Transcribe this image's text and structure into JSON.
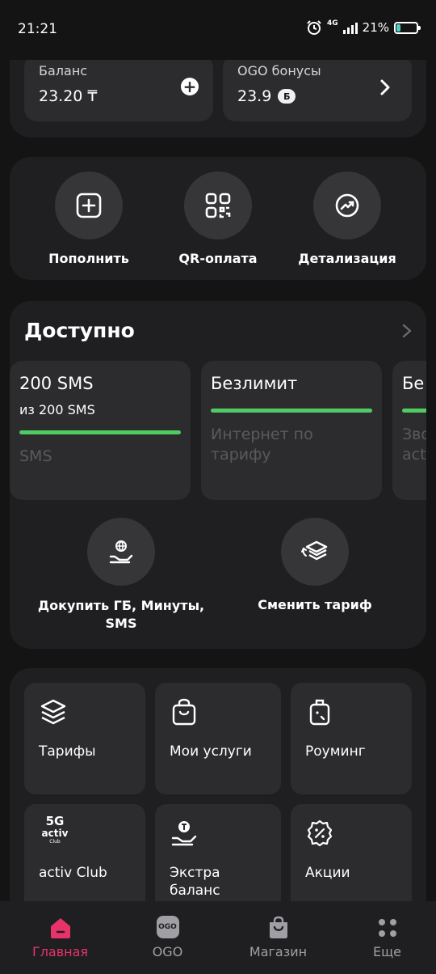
{
  "status": {
    "time": "21:21",
    "network": "4G",
    "battery_text": "21%",
    "battery_level": 0.21
  },
  "balance": {
    "label": "Баланс",
    "value": "23.20 ₸"
  },
  "bonus": {
    "label": "OGO бонусы",
    "value": "23.9",
    "badge": "Б"
  },
  "quick_actions": [
    {
      "label": "Пополнить",
      "icon": "plus-square-icon"
    },
    {
      "label": "QR-оплата",
      "icon": "qr-code-icon"
    },
    {
      "label": "Детализация",
      "icon": "chart-trend-icon"
    }
  ],
  "available": {
    "title": "Доступно",
    "packages": [
      {
        "title": "200 SMS",
        "subtitle": "из 200 SMS",
        "description": "SMS",
        "progress": 1.0
      },
      {
        "title": "Безлимит",
        "subtitle": "",
        "description": "Интернет по тарифу",
        "progress": 1.0
      },
      {
        "title": "Бе",
        "subtitle": "",
        "description": "Зво acti",
        "progress": 1.0
      }
    ],
    "actions": [
      {
        "label": "Докупить ГБ, Минуты, SMS",
        "icon": "globe-hand-icon"
      },
      {
        "label": "Сменить тариф",
        "icon": "layers-refresh-icon"
      }
    ]
  },
  "services": [
    {
      "label": "Тарифы",
      "icon": "layers-icon"
    },
    {
      "label": "Мои услуги",
      "icon": "bag-icon"
    },
    {
      "label": "Роуминг",
      "icon": "luggage-icon"
    },
    {
      "label": "activ Club",
      "icon": "activ-club-logo",
      "logo_top": "5G",
      "logo_mid": "activ",
      "logo_bottom": "Club"
    },
    {
      "label": "Экстра баланс",
      "icon": "coin-hand-icon"
    },
    {
      "label": "Акции",
      "icon": "discount-badge-icon"
    }
  ],
  "bottom_nav": [
    {
      "label": "Главная",
      "icon": "home-icon",
      "active": true
    },
    {
      "label": "OGO",
      "icon": "ogo-icon",
      "badge": "OGO",
      "active": false
    },
    {
      "label": "Магазин",
      "icon": "shop-bag-icon",
      "active": false
    },
    {
      "label": "Еще",
      "icon": "more-dots-icon",
      "active": false
    }
  ],
  "colors": {
    "accent": "#e8336a",
    "progress": "#4fcb62",
    "panel": "#1f1f21",
    "tile": "#2c2c2f",
    "background": "#141414"
  }
}
